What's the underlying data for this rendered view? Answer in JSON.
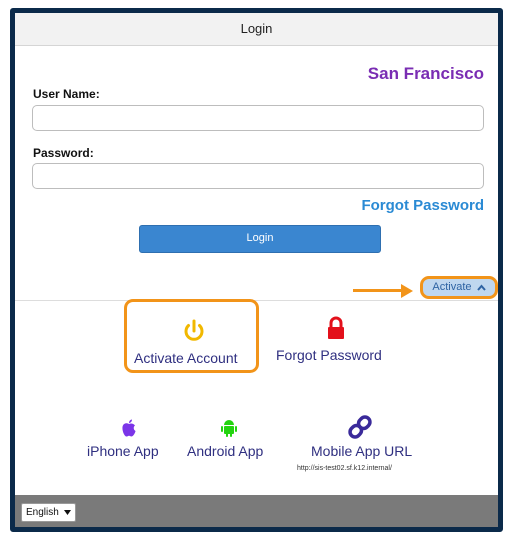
{
  "header": {
    "title": "Login"
  },
  "district": "San Francisco",
  "form": {
    "username_label": "User Name:",
    "username_value": "",
    "password_label": "Password:",
    "password_value": "",
    "forgot_link": "Forgot Password",
    "login_button": "Login"
  },
  "activate": {
    "toggle_label": "Activate"
  },
  "actions": {
    "activate_account": "Activate Account",
    "forgot_password": "Forgot Password"
  },
  "apps": {
    "iphone": "iPhone App",
    "android": "Android App",
    "mobile_url": "Mobile App URL",
    "url": "http://sis-test02.sf.k12.internal/"
  },
  "footer": {
    "language": "English"
  },
  "colors": {
    "accent": "#3a86d0",
    "highlight": "#f29419",
    "district": "#7a2db3",
    "apple": "#7b35e8",
    "android": "#23d40f",
    "lock": "#e3101b",
    "power": "#f1b800",
    "frame": "#0b2a4a"
  },
  "icons": [
    "power-icon",
    "lock-icon",
    "apple-icon",
    "android-icon",
    "link-icon",
    "chevron-up-icon",
    "caret-down-icon",
    "arrow-icon"
  ]
}
